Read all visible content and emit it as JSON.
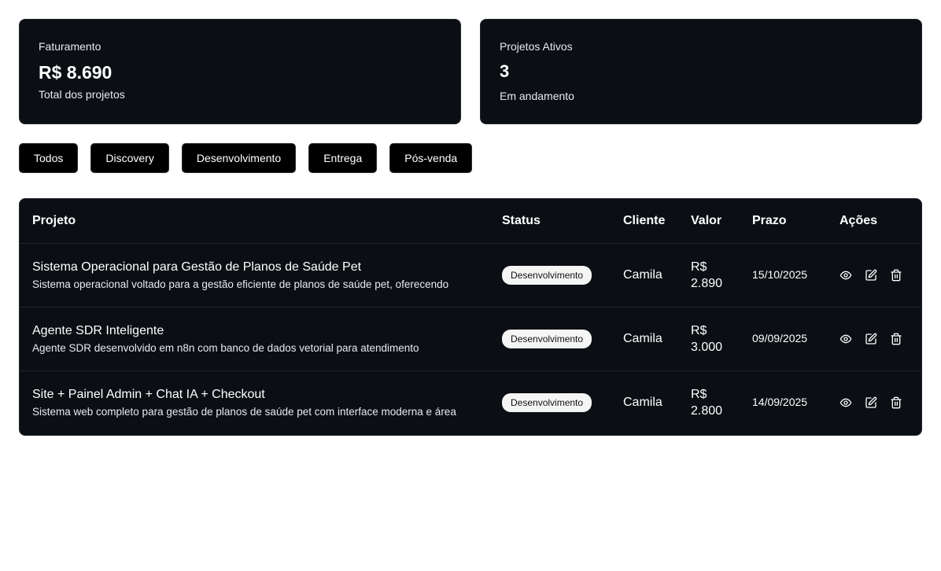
{
  "cards": {
    "revenue": {
      "label": "Faturamento",
      "value": "R$ 8.690",
      "sub": "Total dos projetos"
    },
    "active": {
      "label": "Projetos Ativos",
      "value": "3",
      "sub": "Em andamento"
    }
  },
  "filters": [
    "Todos",
    "Discovery",
    "Desenvolvimento",
    "Entrega",
    "Pós-venda"
  ],
  "table": {
    "headers": {
      "projeto": "Projeto",
      "status": "Status",
      "cliente": "Cliente",
      "valor": "Valor",
      "prazo": "Prazo",
      "acoes": "Ações"
    },
    "rows": [
      {
        "title": "Sistema Operacional para Gestão de Planos de Saúde Pet",
        "description": "Sistema operacional voltado para a gestão eficiente de planos de saúde pet, oferecendo",
        "status": "Desenvolvimento",
        "client": "Camila",
        "value_currency": "R$",
        "value_amount": "2.890",
        "deadline": "15/10/2025"
      },
      {
        "title": "Agente SDR Inteligente",
        "description": "Agente SDR desenvolvido em n8n com banco de dados vetorial para atendimento",
        "status": "Desenvolvimento",
        "client": "Camila",
        "value_currency": "R$",
        "value_amount": "3.000",
        "deadline": "09/09/2025"
      },
      {
        "title": "Site + Painel Admin + Chat IA + Checkout",
        "description": "Sistema web completo para gestão de planos de saúde pet com interface moderna e área",
        "status": "Desenvolvimento",
        "client": "Camila",
        "value_currency": "R$",
        "value_amount": "2.800",
        "deadline": "14/09/2025"
      }
    ],
    "row_actions": [
      "eye-icon",
      "edit-icon",
      "trash-icon"
    ]
  },
  "colors": {
    "panel": "#0b0f14",
    "border": "#1f252d",
    "badge_bg": "#f5f5f5",
    "page_bg": "#ffffff"
  }
}
